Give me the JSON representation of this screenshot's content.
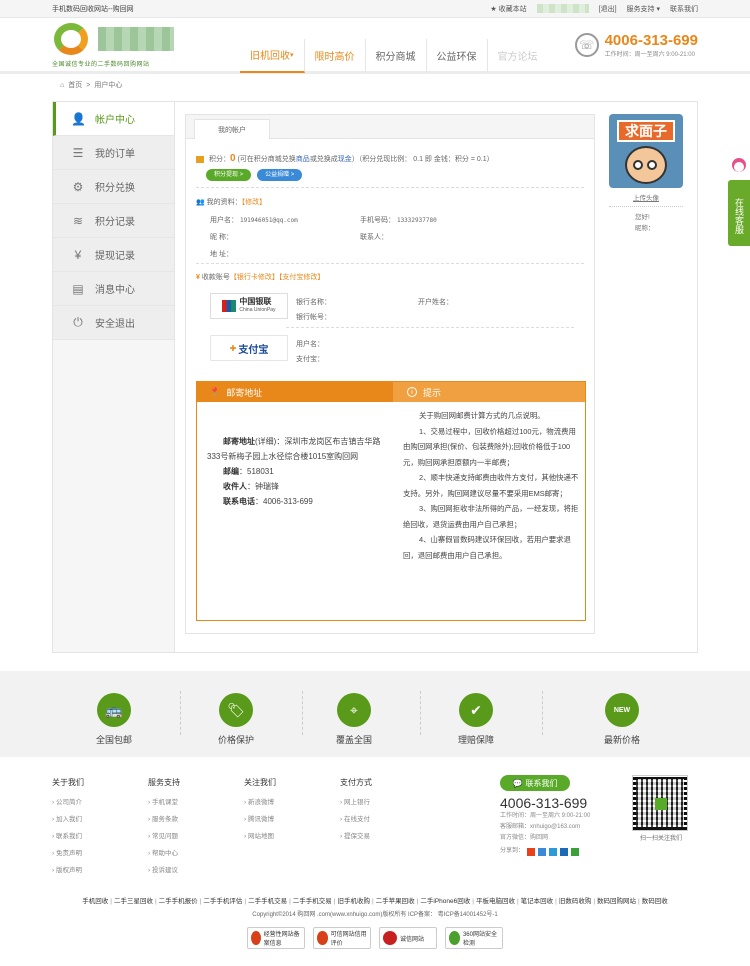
{
  "topbar": {
    "site_name": "手机数码回收网站--购回网",
    "favorite": "收藏本站",
    "logout": "[退出]",
    "service": "服务支持",
    "contact": "联系我们"
  },
  "logo": {
    "slogan": "全国诚信专业的二手数码回购网站"
  },
  "nav": [
    {
      "label": "旧机回收",
      "state": "active"
    },
    {
      "label": "限时高价",
      "state": "hot"
    },
    {
      "label": "积分商城",
      "state": "normal"
    },
    {
      "label": "公益环保",
      "state": "normal"
    },
    {
      "label": "官方论坛",
      "state": "dim"
    }
  ],
  "hotline": {
    "number": "4006-313-699",
    "hours": "工作时间：周一至周六 9:00-21:00"
  },
  "breadcrumb": {
    "home": "首页",
    "sep": ">",
    "current": "用户中心"
  },
  "sidebar": [
    {
      "label": "帐户中心",
      "icon": "user-icon",
      "glyph": "👤",
      "active": true
    },
    {
      "label": "我的订单",
      "icon": "list-icon",
      "glyph": "☰",
      "active": false
    },
    {
      "label": "积分兑换",
      "icon": "exchange-icon",
      "glyph": "⚙",
      "active": false
    },
    {
      "label": "积分记录",
      "icon": "coins-icon",
      "glyph": "≋",
      "active": false
    },
    {
      "label": "提现记录",
      "icon": "yen-icon",
      "glyph": "¥",
      "active": false
    },
    {
      "label": "消息中心",
      "icon": "map-icon",
      "glyph": "▤",
      "active": false
    },
    {
      "label": "安全退出",
      "icon": "power-icon",
      "glyph": "⏻",
      "active": false
    }
  ],
  "account": {
    "tab": "我的帐户",
    "points_label": "积分：",
    "points_value": "0",
    "points_desc_1": "(可在积分商城兑换",
    "points_desc_link1": "商品",
    "points_desc_2": "或兑换成",
    "points_desc_link2": "现金",
    "points_desc_3": "）（积分兑现比例：  0.1 即 金钱：积分 = 0.1）",
    "btn_exchange": "积分提现 >",
    "btn_charity": "公益捐赠 >",
    "profile_title": "我的资料：",
    "profile_edit": "【修改】",
    "username_label": "用户名：",
    "username_value": "191946051@qq.com",
    "mobile_label": "手机号码：",
    "mobile_value": "13332937780",
    "nickname_label": "昵    称：",
    "contact_label": "联系人：",
    "address_label": "地    址：",
    "payee_title": "收款账号",
    "bank_edit": "【银行卡修改】",
    "alipay_edit": "【支付宝修改】",
    "bank_logo": "中国银联",
    "bank_logo_en": "China UnionPay",
    "bank_name_label": "银行名称：",
    "bank_holder_label": "开户姓名：",
    "bank_account_label": "银行帐号：",
    "alipay_logo": "支付宝",
    "alipay_user_label": "用户名：",
    "alipay_account_label": "支付宝："
  },
  "mailing": {
    "title": "邮寄地址",
    "tips_title": "提示",
    "addr_label": "邮寄地址",
    "addr_detail_tag": "(详细)",
    "addr_value": "：深圳市龙岗区布吉镇吉华路333号新梅子园上水径综合楼1015室购回网",
    "zip_label": "邮编",
    "zip_value": "：518031",
    "receiver_label": "收件人",
    "receiver_value": "：钟瑞锋",
    "phone_label": "联系电话",
    "phone_value": "：4006-313-699",
    "tips": [
      "关于购回网邮费计算方式的几点说明。",
      "1、交易过程中，回收价格超过100元，物流费用由购回网承担(保价、包装费除外);回收价格低于100元，购回网承担原额内一半邮费；",
      "2、顺丰快递支持邮费由收件方支付，其他快递不支持。另外，购回网建议尽量不要采用EMS邮寄；",
      "3、购回网拒收非法所得的产品，一经发现，将拒绝回收，退货运费由用户自己承担；",
      "4、山寨假冒数码建议环保回收，若用户要求退回，退回邮费由用户自己承担。"
    ]
  },
  "profile": {
    "sign": "求面子",
    "upload": "上传头像",
    "hello": "您好!",
    "nickname_link": "昵称："
  },
  "chat": {
    "label": "在线客服"
  },
  "features": [
    {
      "label": "全国包邮",
      "icon": "bus-icon",
      "glyph": "🚌"
    },
    {
      "label": "价格保护",
      "icon": "tag-icon",
      "glyph": "🏷"
    },
    {
      "label": "覆盖全国",
      "icon": "map-pin-icon",
      "glyph": "⌖"
    },
    {
      "label": "理赔保障",
      "icon": "shield-icon",
      "glyph": "✔"
    },
    {
      "label": "最新价格",
      "icon": "new-badge-icon",
      "glyph": "NEW"
    }
  ],
  "footer_cols": [
    {
      "title": "关于我们",
      "items": [
        "公司简介",
        "加入我们",
        "联系我们",
        "免责声明",
        "版权声明"
      ]
    },
    {
      "title": "服务支持",
      "items": [
        "手机课堂",
        "服务条款",
        "常见问题",
        "帮助中心",
        "投诉建议"
      ]
    },
    {
      "title": "关注我们",
      "items": [
        "新浪微博",
        "腾讯微博",
        "网站地图"
      ]
    },
    {
      "title": "支付方式",
      "items": [
        "网上银行",
        "在线支付",
        "提保交易"
      ]
    }
  ],
  "contact": {
    "button": "联系我们",
    "number": "4006-313-699",
    "hours": "工作时间：周一至周六 9:00-21:00",
    "email": "客服邮箱：xnhuigo@163.com",
    "wechat": "官方微信：购回网",
    "share": "分享到："
  },
  "qr": {
    "label": "扫一扫关注我们"
  },
  "links": [
    "手机回收",
    "二手三星回收",
    "二手手机报价",
    "二手手机评估",
    "二手手机交易",
    "二手手机交易",
    "旧手机收购",
    "二手苹果回收",
    "二手iPhone6回收",
    "平板电脑回收",
    "笔记本回收",
    "旧数码收购",
    "数码回购网站",
    "数码回收"
  ],
  "copyright": "Copyright©2014 购回网 .com(www.xnhuigo.com)版权所有  ICP备案：   粤ICP备14001452号-1",
  "badges": [
    {
      "label": "经营性网站备案信息",
      "color": "#d8401a"
    },
    {
      "label": "可信网站信用评价",
      "color": "#d8401a"
    },
    {
      "label": "诚信网站",
      "color": "#c82020"
    },
    {
      "label": "360网站安全检测",
      "color": "#4aa02a"
    }
  ]
}
